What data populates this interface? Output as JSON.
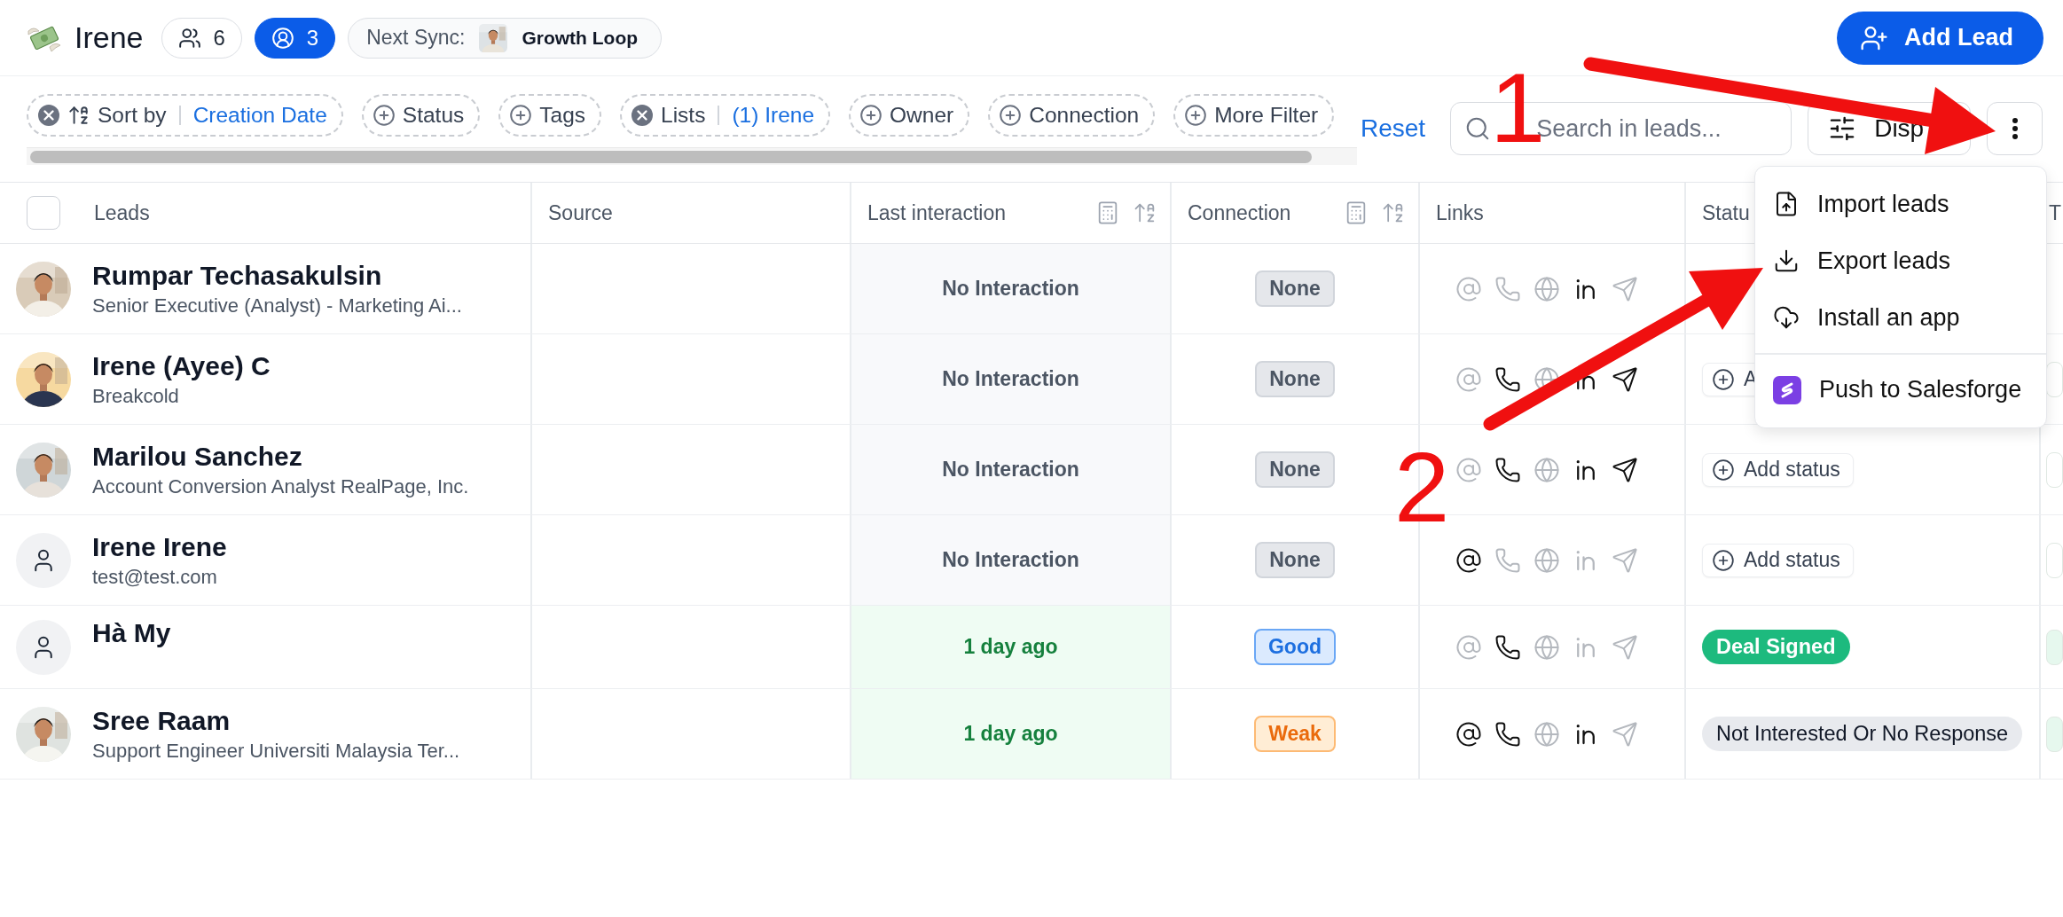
{
  "header": {
    "title": "Irene",
    "members_count": "6",
    "targets_count": "3",
    "sync_label": "Next Sync:",
    "sync_name": "Growth Loop",
    "add_button": "Add Lead"
  },
  "filters": [
    {
      "kind": "sort",
      "label": "Sort by",
      "value": "Creation Date"
    },
    {
      "kind": "add",
      "label": "Status"
    },
    {
      "kind": "add",
      "label": "Tags"
    },
    {
      "kind": "applied",
      "label": "Lists",
      "value": "(1) Irene"
    },
    {
      "kind": "add",
      "label": "Owner"
    },
    {
      "kind": "add",
      "label": "Connection"
    },
    {
      "kind": "add",
      "label": "More Filter"
    }
  ],
  "reset": "Reset",
  "search": {
    "placeholder": "Search in leads..."
  },
  "display_button": "Disp",
  "table": {
    "select_all": {
      "checked": false
    },
    "columns": [
      {
        "label": "Leads",
        "kind": "check"
      },
      {
        "label": "Source",
        "kind": "plain"
      },
      {
        "label": "Last interaction",
        "kind": "tools"
      },
      {
        "label": "Connection",
        "kind": "tools"
      },
      {
        "label": "Links",
        "kind": "plain"
      },
      {
        "label": "Statu",
        "kind": "plain"
      },
      {
        "label": "T",
        "kind": "plain"
      }
    ],
    "rows": [
      {
        "name": "Rumpar Techasakulsin",
        "subtitle": "Senior Executive (Analyst) - Marketing Ai...",
        "avatar": {
          "kind": "picture"
        },
        "last_interaction": {
          "text": "No Interaction",
          "kind": "none"
        },
        "connection": {
          "text": "None",
          "kind": "none"
        },
        "links": [
          {
            "kind": "email",
            "active": false
          },
          {
            "kind": "phone",
            "active": false
          },
          {
            "kind": "web",
            "active": false
          },
          {
            "kind": "linkedin",
            "active": true
          },
          {
            "kind": "telegram",
            "active": false
          }
        ]
      },
      {
        "name": "Irene (Ayee) C",
        "subtitle": "Breakcold",
        "avatar": {
          "kind": "picture"
        },
        "last_interaction": {
          "text": "No Interaction",
          "kind": "none"
        },
        "connection": {
          "text": "None",
          "kind": "none"
        },
        "links": [
          {
            "kind": "email",
            "active": false
          },
          {
            "kind": "phone",
            "active": true
          },
          {
            "kind": "web",
            "active": false
          },
          {
            "kind": "linkedin",
            "active": true
          },
          {
            "kind": "telegram",
            "active": true
          }
        ],
        "status": {
          "kind": "add",
          "text": "A"
        },
        "tag_stub": {
          "color": "#ffffff"
        }
      },
      {
        "name": "Marilou Sanchez",
        "subtitle": "Account Conversion Analyst RealPage, Inc.",
        "avatar": {
          "kind": "picture"
        },
        "last_interaction": {
          "text": "No Interaction",
          "kind": "none"
        },
        "connection": {
          "text": "None",
          "kind": "none"
        },
        "links": [
          {
            "kind": "email",
            "active": false
          },
          {
            "kind": "phone",
            "active": true
          },
          {
            "kind": "web",
            "active": false
          },
          {
            "kind": "linkedin",
            "active": true
          },
          {
            "kind": "telegram",
            "active": true
          }
        ],
        "status": {
          "kind": "add",
          "text": "Add status"
        },
        "tag_stub": {
          "color": "#ffffff"
        }
      },
      {
        "name": "Irene Irene",
        "subtitle": "test@test.com",
        "avatar": {
          "kind": "placeholder"
        },
        "last_interaction": {
          "text": "No Interaction",
          "kind": "none"
        },
        "connection": {
          "text": "None",
          "kind": "none"
        },
        "links": [
          {
            "kind": "email",
            "active": true
          },
          {
            "kind": "phone",
            "active": false
          },
          {
            "kind": "web",
            "active": false
          },
          {
            "kind": "linkedin",
            "active": false
          },
          {
            "kind": "telegram",
            "active": false
          }
        ],
        "status": {
          "kind": "add",
          "text": "Add status"
        },
        "tag_stub": {
          "color": "#ffffff"
        }
      },
      {
        "name": "Hà My",
        "avatar": {
          "kind": "placeholder"
        },
        "last_interaction": {
          "text": "1 day ago",
          "kind": "recent"
        },
        "connection": {
          "text": "Good",
          "kind": "good"
        },
        "links": [
          {
            "kind": "email",
            "active": false
          },
          {
            "kind": "phone",
            "active": true
          },
          {
            "kind": "web",
            "active": false
          },
          {
            "kind": "linkedin",
            "active": false
          },
          {
            "kind": "telegram",
            "active": false
          }
        ],
        "status": {
          "kind": "solid",
          "text": "Deal Signed",
          "color": "#1dba7e"
        },
        "tag_stub": {
          "color": "#e6f8ee"
        }
      },
      {
        "name": "Sree Raam",
        "subtitle": "Support Engineer Universiti Malaysia Ter...",
        "avatar": {
          "kind": "picture"
        },
        "last_interaction": {
          "text": "1 day ago",
          "kind": "recent"
        },
        "connection": {
          "text": "Weak",
          "kind": "weak"
        },
        "links": [
          {
            "kind": "email",
            "active": true
          },
          {
            "kind": "phone",
            "active": true
          },
          {
            "kind": "web",
            "active": false
          },
          {
            "kind": "linkedin",
            "active": true
          },
          {
            "kind": "telegram",
            "active": false
          }
        ],
        "status": {
          "kind": "soft",
          "text": "Not Interested Or No Response",
          "color": "#e8eaee"
        },
        "tag_stub": {
          "color": "#e6f8ee"
        }
      }
    ]
  },
  "menu": {
    "items": [
      {
        "kind": "import",
        "label": "Import leads"
      },
      {
        "kind": "export",
        "label": "Export leads"
      },
      {
        "kind": "install",
        "label": "Install an app"
      },
      {
        "kind": "salesforge",
        "label": "Push to Salesforge"
      }
    ]
  },
  "annotations": [
    {
      "label": "1"
    },
    {
      "label": "2"
    }
  ]
}
